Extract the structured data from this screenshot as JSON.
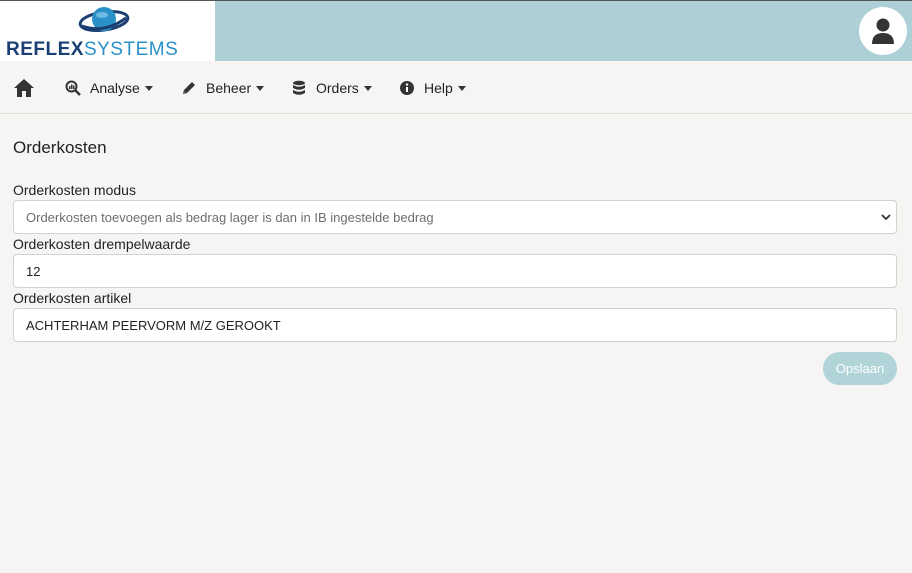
{
  "header": {
    "logo": {
      "word1": "REFLEX",
      "word2": "SYSTEMS",
      "icon": "globe-logo-icon"
    },
    "user_icon": "user-avatar-icon"
  },
  "nav": {
    "home_icon": "home-icon",
    "items": [
      {
        "label": "Analyse",
        "icon": "search-chart-icon"
      },
      {
        "label": "Beheer",
        "icon": "pencil-icon"
      },
      {
        "label": "Orders",
        "icon": "database-icon"
      },
      {
        "label": "Help",
        "icon": "info-circle-icon"
      }
    ]
  },
  "page": {
    "title": "Orderkosten",
    "fields": {
      "modus": {
        "label": "Orderkosten modus",
        "value": "Orderkosten toevoegen als bedrag lager is dan in IB ingestelde bedrag"
      },
      "drempel": {
        "label": "Orderkosten drempelwaarde",
        "value": "12"
      },
      "artikel": {
        "label": "Orderkosten artikel",
        "value": "ACHTERHAM PEERVORM M/Z GEROOKT"
      }
    },
    "save_label": "Opslaan"
  },
  "colors": {
    "header_bg": "#acd0d6",
    "page_bg": "#f6f5f3",
    "button_bg": "#b1d4d9",
    "logo_dark": "#1b3f73",
    "logo_light": "#2a91c8"
  }
}
